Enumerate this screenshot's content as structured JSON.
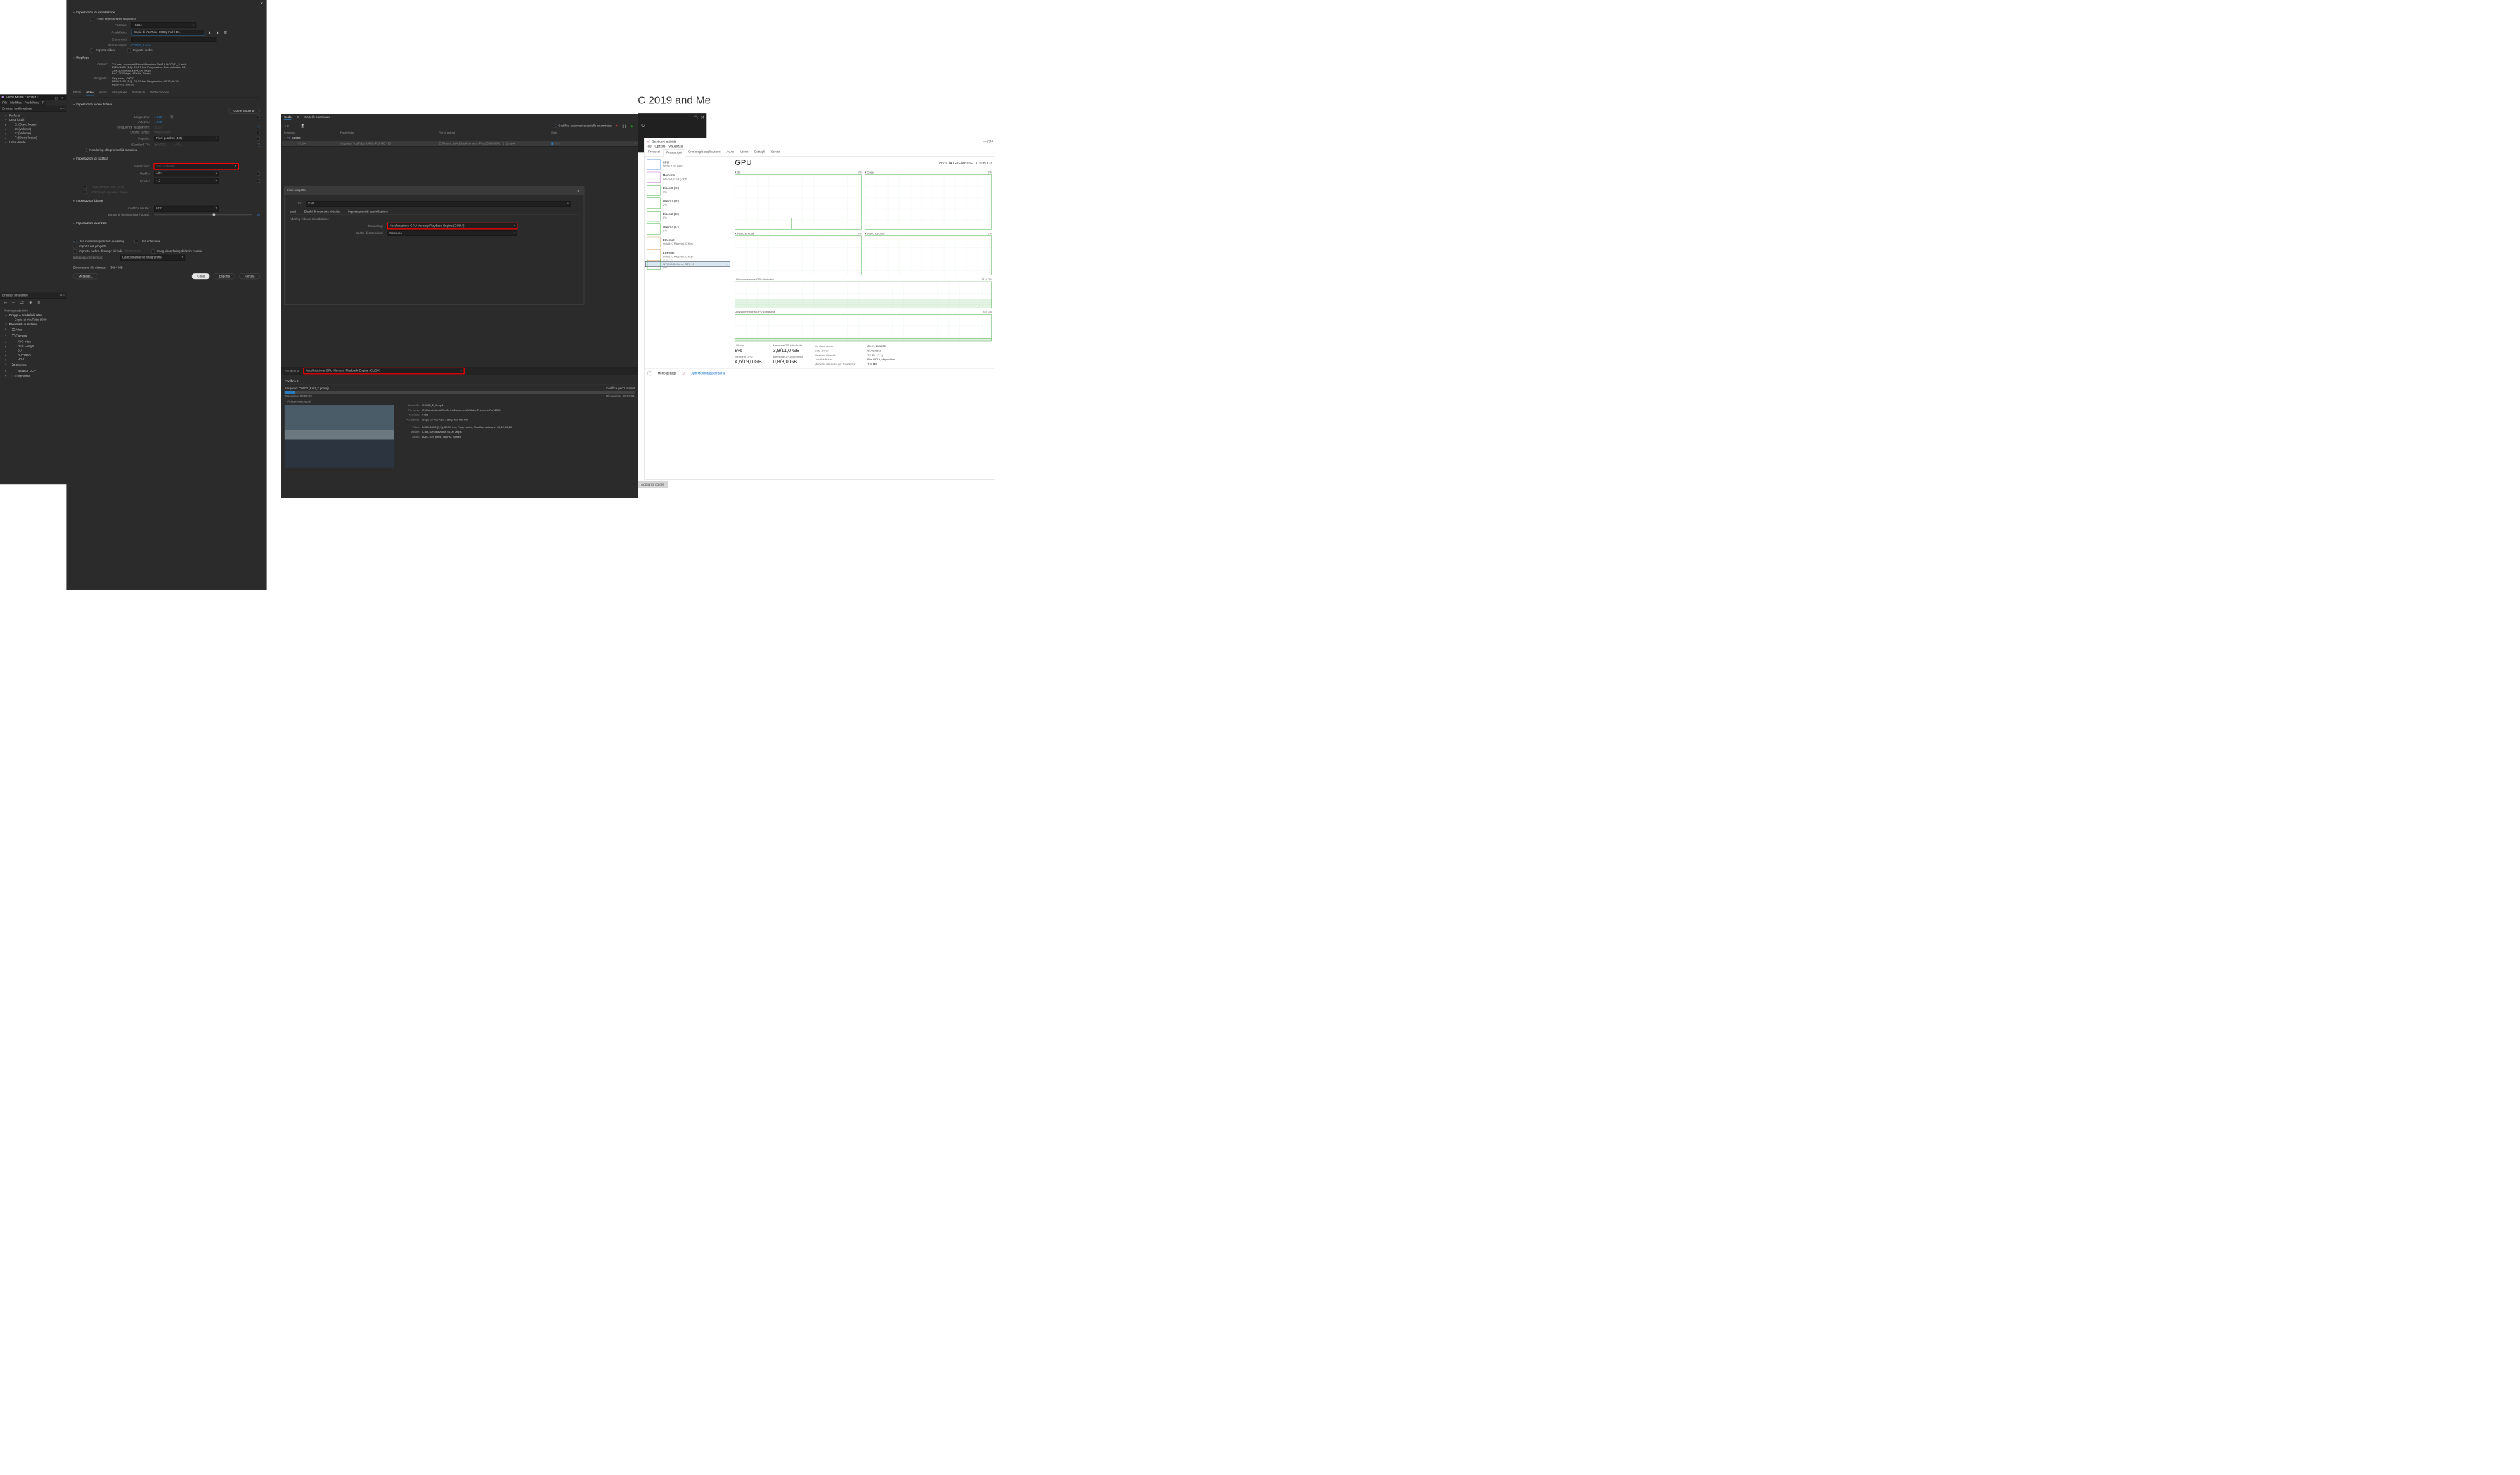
{
  "bg_text": "C 2019 and Me",
  "aggiungi": "Aggiungi colore",
  "ame_titlebar": {
    "title": "Adobe Media Encoder C"
  },
  "left_menu": [
    "File",
    "Modifica",
    "Predefinito",
    "F"
  ],
  "left_tab": "Browser multimediale",
  "left_tree": {
    "fav": "Preferiti",
    "locali": "Unità locali",
    "drives": [
      "C: (Disco locale)",
      "D: (Volume)",
      "E: (Volume)",
      "F: (Disco locale)"
    ],
    "rete": "Unità di rete"
  },
  "preset_panel": {
    "tab": "Browser predefiniti",
    "nome": "Nome predefinito",
    "g1": "Gruppi e predefiniti uten",
    "g1i": "Copia di YouTube 1080",
    "sys": "Predefiniti di sistema",
    "altro": "Altro",
    "camera": "Camera",
    "cam_items": [
      "AVC-Intra",
      "AVC-LongG",
      "DV",
      "DVCPRO",
      "HDV"
    ],
    "cinema": "Cinema",
    "cin_items": [
      "Wraptor DCP"
    ],
    "disp": "Dispositivi"
  },
  "export": {
    "h1": "Impostazioni di esportazione",
    "seq_chk": "Come impostazioni sequenza",
    "formato_lbl": "Formato:",
    "formato": "H.264",
    "pred_lbl": "Predefinito:",
    "pred": "Copia di YouTube 1080p Full HD...",
    "commenti_lbl": "Commenti:",
    "out_lbl": "Nome output:",
    "out": "C0002_3.mp4",
    "ev": "Esporta video",
    "ea": "Esporta audio",
    "riep": "Riepilogo",
    "out_text": "C:\\User...ocumenti\\Adobe\\Premiere Pro\\13.0\\C0002_3.mp4\n1920x1080 (1,0), 29,97 fps, Progressivo, Solo software, 00;\nCBR, Destinazione 40,00 Mbps\nAAC, 320 kbps, 48 kHz, Stereo",
    "src_lbl": "Sorgente:",
    "src_text": "Sequenza, C0002\n3840x2160 (1,0), 29,97 fps, Progressivo, 00;12;09;20\n48000 Hz, Stereo",
    "tabs": [
      "Effetti",
      "Video",
      "Audio",
      "Multiplexer",
      "Sottotitoli",
      "Pubblicazione"
    ],
    "vbase": "Impostazioni video di base",
    "src_btn": "Come sorgente",
    "w_lbl": "Larghezza:",
    "w": "1.920",
    "h_lbl": "Altezza:",
    "h": "1.080",
    "fps_lbl": "Frequenza fotogrammi:",
    "fps": "29,97",
    "order_lbl": "Ordine campi:",
    "order": "Progressivo",
    "aspect_lbl": "Aspetto:",
    "aspect": "Pixel quadrati (1,0)",
    "tv_lbl": "Standard TV:",
    "ntsc": "NTSC",
    "pal": "PAL",
    "maxdepth": "Rendering alla profondità massima",
    "enc": "Impostazioni di codifica",
    "perf_lbl": "Prestazioni:",
    "perf": "Solo software",
    "profilo_lbl": "Profilo:",
    "profilo": "Alto",
    "livello_lbl": "Livello:",
    "livello": "4.2",
    "c1": "Colori primari Rec. 2020",
    "c2": "HDR (High dynamic range)",
    "bit": "Impostazioni bitrate",
    "cb_lbl": "Codifica bitrate:",
    "cb": "CBR",
    "bd_lbl": "Bitrate di destinazione [Mbps]:",
    "bd": "40",
    "adv": "Impostazioni avanzate",
    "maxq": "Usa massima qualità di rendering",
    "anteprime": "Usa anteprime",
    "imp": "Importa nel progetto",
    "tc": "Imposta codice di tempo iniziale",
    "tc_v": "00;00;00;00",
    "solo": "Esegui rendering del solo canale",
    "interp_lbl": "Interpolazione tempo:",
    "interp": "Campionamento fotogrammi",
    "size_lbl": "Dimensione file stimata:",
    "size": "3494 MB",
    "b_meta": "Metadati...",
    "b_coda": "Coda",
    "b_exp": "Esporta",
    "b_ann": "Annulla"
  },
  "ame": {
    "tab_coda": "Coda",
    "tab_cart": "Cartelle esaminate",
    "auto": "Codifica automatica cartelle esaminate",
    "col_f": "Formato",
    "col_p": "Predefinito",
    "col_o": "File di output",
    "col_s": "Stato",
    "row1_name": "C0002",
    "row2_f": "H.264",
    "row2_p": "Copia di YouTube 1080p Full HD HQ",
    "row2_o": "C:\\Users...ti\\Adobe\\Premiere Pro\\13.0\\C0002_2_2.mp4",
    "dlg_title": "zioni progetto",
    "to_lbl": "to:",
    "to": "Kart",
    "dlg_tabs": [
      "erali",
      "Dischi di memoria virtuale",
      "Impostazioni di assimilazione"
    ],
    "rvs": "ndering video e riproduzione",
    "rend_lbl": "Rendering:",
    "rend": "Accelerazione GPU Mercury Playback Engine (CUDA)",
    "cache_lbl": "Cache di anteprima:",
    "cache": "Nessuno",
    "bar_rend_lbl": "Rendering:",
    "bar_rend": "Accelerazione GPU Mercury Playback Engine (CUDA)",
    "stat_tab": "Codifica",
    "src": "Sorgente: C0002 (Kart_2.prproj)",
    "per1": "Codifica per 1 output",
    "elapsed": "Trascorso: 00:00:20",
    "remain": "Rimanente: 00:19:01",
    "ant": "Anteprima output",
    "meta": {
      "nf_k": "Nome file:",
      "nf": "C0002_2_2.mp4",
      "pc_k": "Percorso:",
      "pc": "C:\\Users\\aless\\OneDrive\\Documenti\\Adobe\\Premiere Pro\\13.0\\",
      "fm_k": "Formato:",
      "fm": "H.264",
      "pd_k": "Predefinito:",
      "pd": "Copia di YouTube 1080p Full HD HQ",
      "vd_k": "Video:",
      "vd": "1920x1080 (1,0), 29,97 fps, Progressivo, Codifica software, 00;12;06;29",
      "bt_k": "Bitrate:",
      "bt": "CBR, Destinazione 40,00 Mbps",
      "au_k": "Audio:",
      "au": "AAC, 320 kbps, 48 kHz, Stereo"
    }
  },
  "tm": {
    "title": "Gestione attività",
    "menu": [
      "File",
      "Opzioni",
      "Visualizza"
    ],
    "tabs": [
      "Processi",
      "Prestazioni",
      "Cronologia applicazioni",
      "Avvio",
      "Utenti",
      "Dettagli",
      "Servizi"
    ],
    "sb": [
      {
        "name": "CPU",
        "sub": "100%  6,03 GHz",
        "c": "#3a8cd4"
      },
      {
        "name": "Memoria",
        "sub": "12,0/15,9 GB (75%)",
        "c": "#b547c4"
      },
      {
        "name": "Disco 0 (C:)",
        "sub": "2%",
        "c": "#1a9c1a"
      },
      {
        "name": "Disco 1 (D:)",
        "sub": "2%",
        "c": "#1a9c1a"
      },
      {
        "name": "Disco 2 (E:)",
        "sub": "0%",
        "c": "#1a9c1a"
      },
      {
        "name": "Disco 3 (F:)",
        "sub": "0%",
        "c": "#1a9c1a"
      },
      {
        "name": "Ethernet",
        "sub": "Inviati: 0  Ricevuti: 0 Kbp",
        "c": "#c98a32"
      },
      {
        "name": "Ethernet",
        "sub": "Inviati: 0  Ricevuti: 0 Kbp",
        "c": "#c98a32"
      },
      {
        "name": "GPU 0",
        "sub": "NVIDIA GeForce GTX 10\n8%",
        "c": "#1a9c1a",
        "sel": true
      }
    ],
    "gpu_title": "GPU",
    "gpu_name": "NVIDIA GeForce GTX 1080 Ti",
    "c3d": "3D",
    "c3d_v": "1%",
    "ccopy": "Copy",
    "ccopy_v": "0%",
    "cve": "Video Encode",
    "cve_v": "0%",
    "cvd": "Video Decode",
    "cvd_v": "0%",
    "mded": "Utilizzo memoria GPU dedicata",
    "mded_v": "11,0 GB",
    "mcon": "Utilizzo memoria GPU condivisa",
    "mcon_v": "8,0 GB",
    "stats": {
      "u_k": "Utilizzo",
      "u": "8%",
      "mg_k": "Memoria GPU",
      "mg": "4,6/19,0 GB",
      "md_k": "Memoria GPU dedicata",
      "md": "3,8/11,0 GB",
      "mc_k": "Memoria GPU condivisa",
      "mc": "0,8/8,0 GB",
      "vd_k": "Versione driver:",
      "vd": "25.21.14.1935",
      "dd_k": "Data driver:",
      "dd": "01/03/2019",
      "dx_k": "Versione DirectX:",
      "dx": "12 (FL 12.1)",
      "lf_k": "Località fisica:",
      "lf": "Bus PCI 1, dispositivo...",
      "mr_k": "Memoria riservata per l'hardware:",
      "mr": "137 MB"
    },
    "less": "Meno dettagli",
    "mon": "Apri Monitoraggio risorse"
  }
}
